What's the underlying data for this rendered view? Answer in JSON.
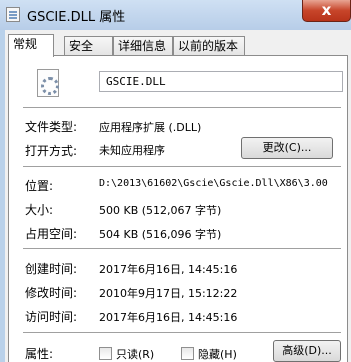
{
  "window": {
    "title": "GSCIE.DLL 属性",
    "close_label": "x"
  },
  "tabs": [
    {
      "label": "常规",
      "active": true
    },
    {
      "label": "安全",
      "active": false
    },
    {
      "label": "详细信息",
      "active": false
    },
    {
      "label": "以前的版本",
      "active": false
    }
  ],
  "general": {
    "file_icon": "dll-file-icon",
    "file_name": "GSCIE.DLL",
    "file_type_label": "文件类型:",
    "file_type_value": "应用程序扩展 (.DLL)",
    "open_with_label": "打开方式:",
    "open_with_value": "未知应用程序",
    "change_button": "更改(C)...",
    "location_label": "位置:",
    "location_value": "D:\\2013\\61602\\Gscie\\Gscie.Dll\\X86\\3.00",
    "size_label": "大小:",
    "size_value": "500 KB (512,067 字节)",
    "size_on_disk_label": "占用空间:",
    "size_on_disk_value": "504 KB (516,096 字节)",
    "created_label": "创建时间:",
    "created_value": "2017年6月16日, 14:45:16",
    "modified_label": "修改时间:",
    "modified_value": "2010年9月17日, 15:12:22",
    "accessed_label": "访问时间:",
    "accessed_value": "2017年6月16日, 14:45:16",
    "attributes_label": "属性:",
    "readonly_label": "只读(R)",
    "readonly_checked": false,
    "hidden_label": "隐藏(H)",
    "hidden_checked": false,
    "advanced_button": "高级(D)..."
  },
  "colors": {
    "titlebar": "#b9d1ea",
    "close_button": "#c7452a",
    "panel_background": "#ffffff",
    "dialog_background": "#f0f0f0"
  }
}
